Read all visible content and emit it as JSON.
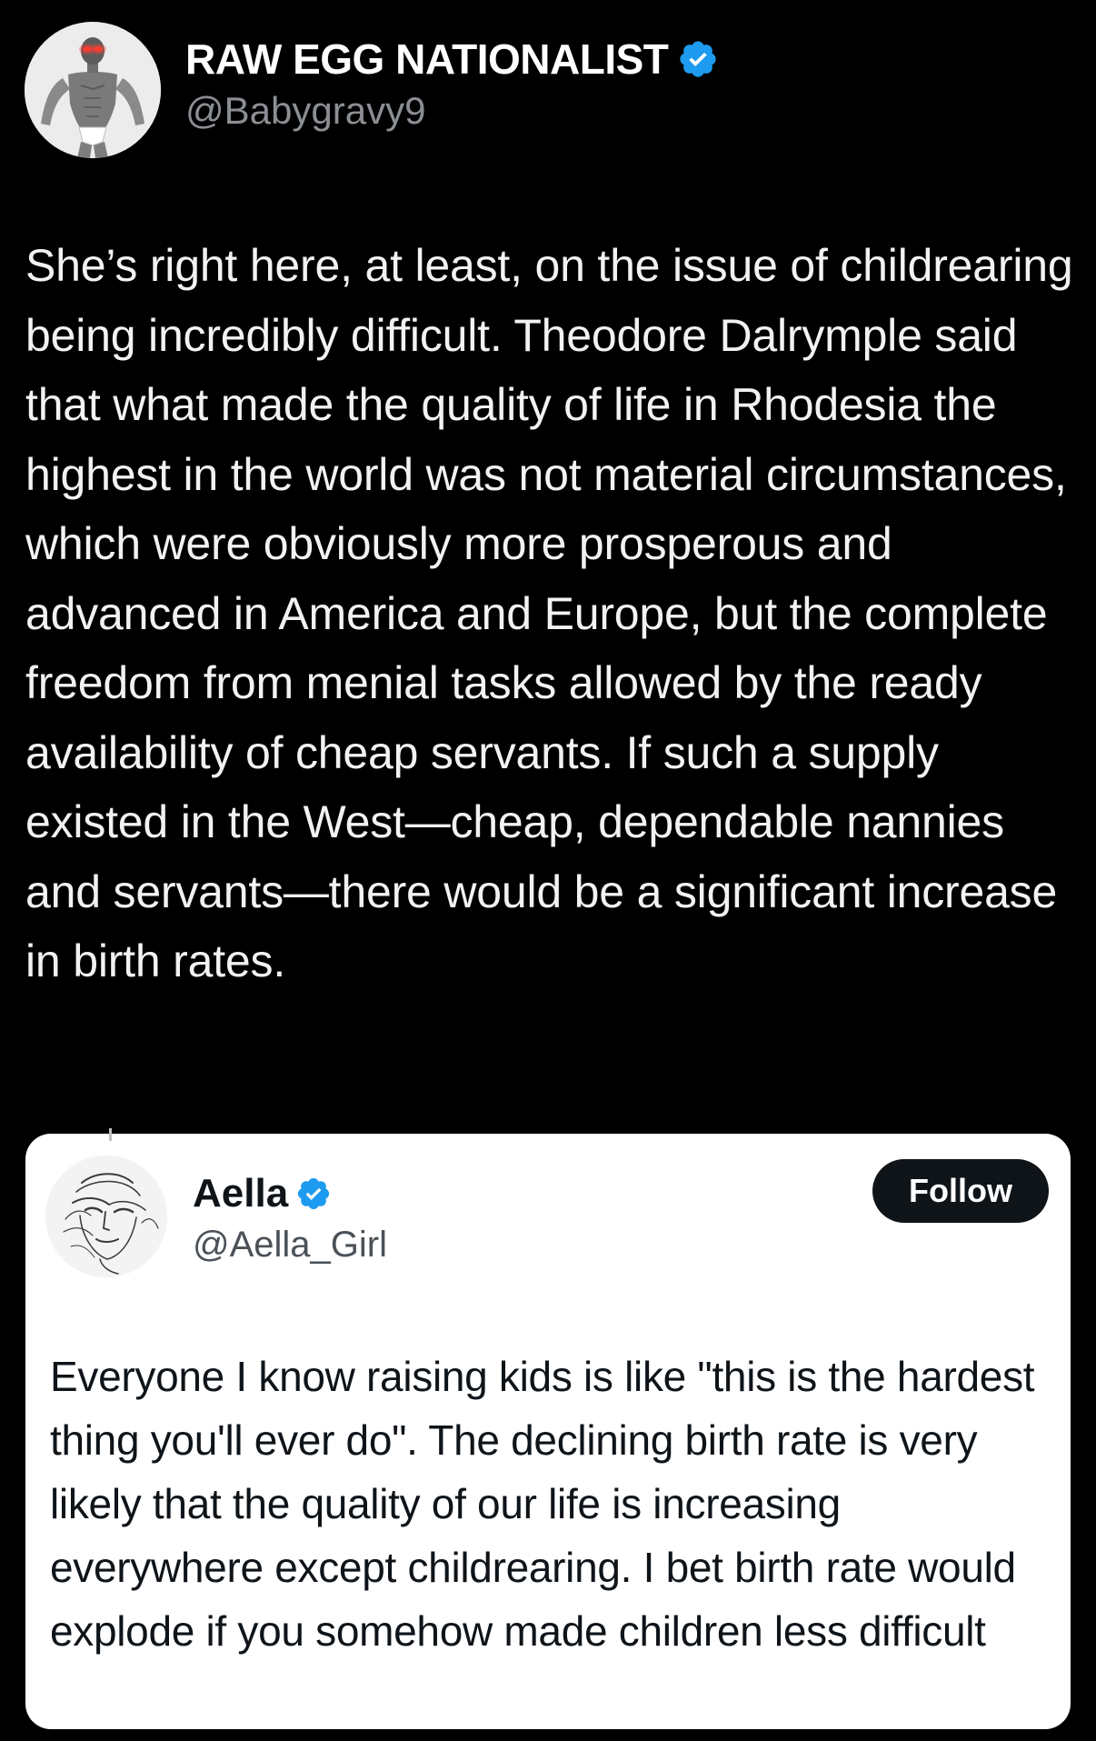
{
  "colors": {
    "background": "#000000",
    "verified_blue": "#1d9bf0",
    "handle_gray": "#8b8f94",
    "card_background": "#ffffff",
    "follow_button": "#0f1419"
  },
  "tweet": {
    "author": {
      "display_name": "RAW EGG NATIONALIST",
      "handle": "@Babygravy9",
      "verified": true,
      "avatar_icon": "bodybuilder-avatar"
    },
    "text": "She’s right here, at least, on the issue of childrearing being incredibly difficult. Theodore Dalrymple said that what made the quality of life in Rhodesia the highest in the world was not material circumstances, which were obviously more prosperous and advanced in America and Europe, but the complete freedom from menial tasks allowed by the ready availability of cheap servants. If such a supply existed in the West—cheap, dependable nannies and servants—there would be a significant increase in birth rates."
  },
  "quoted_tweet": {
    "author": {
      "display_name": "Aella",
      "handle": "@Aella_Girl",
      "verified": true,
      "avatar_icon": "sketch-portrait-avatar"
    },
    "follow_label": "Follow",
    "text": "Everyone I know raising kids is like \"this is the hardest thing you'll ever do\". The declining birth rate is very likely that the quality of our life is increasing everywhere except childrearing. I bet birth rate would explode if you somehow made children less difficult"
  }
}
